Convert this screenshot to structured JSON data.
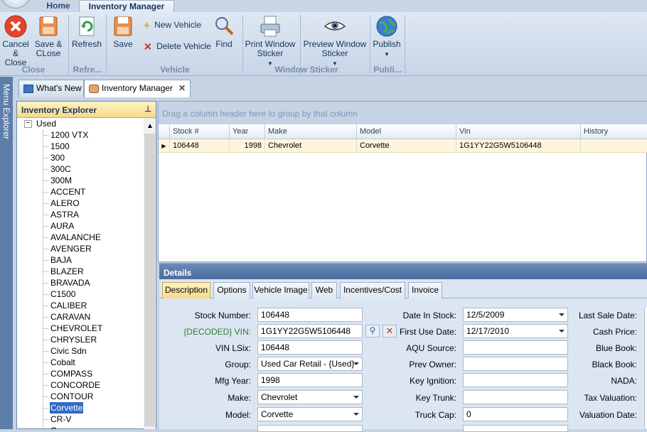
{
  "ribbon": {
    "tabs": [
      "Home",
      "Inventory Manager"
    ],
    "buttons": {
      "cancel_close": "Cancel & Close",
      "save_close": "Save & CLose",
      "refresh": "Refresh",
      "save": "Save",
      "new_vehicle": "New Vehicle",
      "delete_vehicle": "Delete Vehicle",
      "find": "Find",
      "print_sticker": "Print Window Sticker",
      "preview_sticker": "Preview Window Sticker",
      "publish": "Publish"
    },
    "groups": [
      "Close",
      "Refre...",
      "Vehicle",
      "Window Sticker",
      "Publi..."
    ]
  },
  "menu_explorer": "Menu Explorer",
  "doc_tabs": [
    "What's New",
    "Inventory Manager"
  ],
  "explorer": {
    "title": "Inventory Explorer",
    "root": "Used",
    "items": [
      "1200 VTX",
      "1500",
      "300",
      "300C",
      "300M",
      "ACCENT",
      "ALERO",
      "ASTRA",
      "AURA",
      "AVALANCHE",
      "AVENGER",
      "BAJA",
      "BLAZER",
      "BRAVADA",
      "C1500",
      "CALIBER",
      "CARAVAN",
      "CHEVROLET",
      "CHRYSLER",
      "Civic Sdn",
      "Cobalt",
      "COMPASS",
      "CONCORDE",
      "CONTOUR",
      "Corvette",
      "CR-V",
      "C..."
    ],
    "selected": "Corvette"
  },
  "grid": {
    "group_hint": "Drag a column header here to group by that column",
    "columns": [
      "Stock #",
      "Year",
      "Make",
      "Model",
      "Vin",
      "History"
    ],
    "rows": [
      {
        "stock": "106448",
        "year": "1998",
        "make": "Chevrolet",
        "model": "Corvette",
        "vin": "1G1YY22G5W5106448",
        "history": ""
      }
    ]
  },
  "details": {
    "title": "Details",
    "tabs": [
      "Description",
      "Options",
      "Vehicle Image",
      "Web",
      "Incentives/Cost",
      "Invoice"
    ],
    "active_tab": "Description",
    "col1": [
      {
        "label": "Stock Number:",
        "value": "106448"
      },
      {
        "label": "{DECODED} VIN:",
        "value": "1G1YY22G5W5106448"
      },
      {
        "label": "VIN LSix:",
        "value": "106448"
      },
      {
        "label": "Group:",
        "value": "Used Car Retail - {Used}"
      },
      {
        "label": "Mfg Year:",
        "value": "1998"
      },
      {
        "label": "Make:",
        "value": "Chevrolet"
      },
      {
        "label": "Model:",
        "value": "Corvette"
      }
    ],
    "col2": [
      {
        "label": "Date In Stock:",
        "value": "12/5/2009"
      },
      {
        "label": "First Use Date:",
        "value": "12/17/2010"
      },
      {
        "label": "AQU Source:",
        "value": ""
      },
      {
        "label": "Prev Owner:",
        "value": ""
      },
      {
        "label": "Key Ignition:",
        "value": ""
      },
      {
        "label": "Key Trunk:",
        "value": ""
      },
      {
        "label": "Truck Cap:",
        "value": "0"
      }
    ],
    "col3": [
      "Last Sale Date:",
      "Cash Price:",
      "Blue Book:",
      "Black Book:",
      "NADA:",
      "Tax Valuation:",
      "Valuation Date:"
    ],
    "colors": {
      "decoded_label": "#2e7d32"
    }
  }
}
